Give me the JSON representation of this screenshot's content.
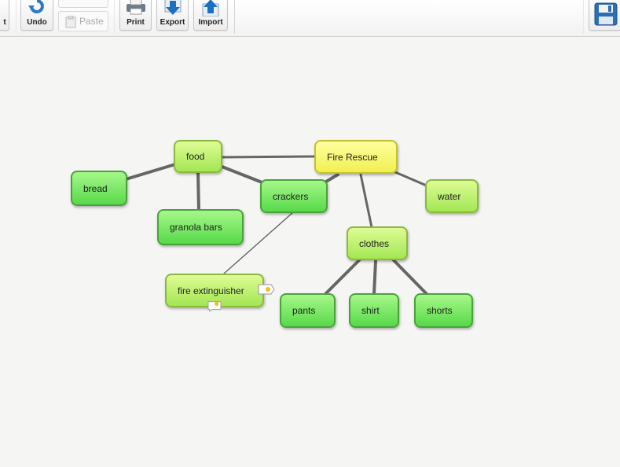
{
  "toolbar": {
    "undo_label": "Undo",
    "paste_label": "Paste",
    "print_label": "Print",
    "export_label": "Export",
    "import_label": "Import",
    "partial_left_label": "t"
  },
  "map": {
    "nodes": {
      "fire_rescue": "Fire Rescue",
      "food": "food",
      "bread": "bread",
      "granola_bars": "granola bars",
      "crackers": "crackers",
      "water": "water",
      "clothes": "clothes",
      "fire_extinguisher": "fire extinguisher",
      "pants": "pants",
      "shirt": "shirt",
      "shorts": "shorts"
    },
    "colors": {
      "green": "#5cdc4d",
      "lime": "#b7ee63",
      "yellow": "#f5f45c",
      "link": "#666666"
    }
  }
}
